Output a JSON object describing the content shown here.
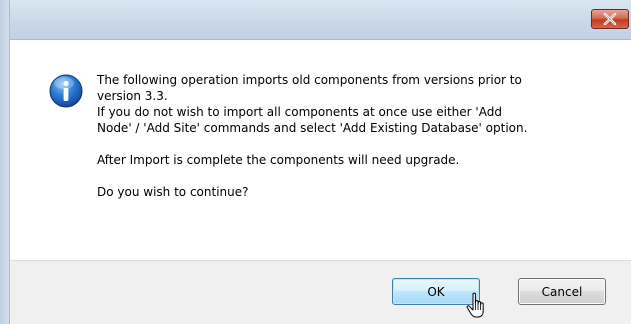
{
  "window": {
    "title": ""
  },
  "titlebar": {
    "close_icon": "close-icon"
  },
  "dialog": {
    "icon": "info-icon",
    "message_lines": [
      "The following operation imports old components from versions prior to",
      "version 3.3.",
      "If you do not wish to import all components at once use either 'Add",
      "Node' / 'Add Site' commands and select 'Add Existing Database' option."
    ],
    "upgrade_note": "After Import is complete the components will need upgrade.",
    "question": "Do you wish to continue?"
  },
  "buttons": {
    "ok_label": "OK",
    "cancel_label": "Cancel"
  },
  "colors": {
    "close_red": "#c23b22",
    "ok_border": "#3c7fb1",
    "footer_bg": "#f0f0f0"
  },
  "cursor": "hand-pointer-cursor"
}
